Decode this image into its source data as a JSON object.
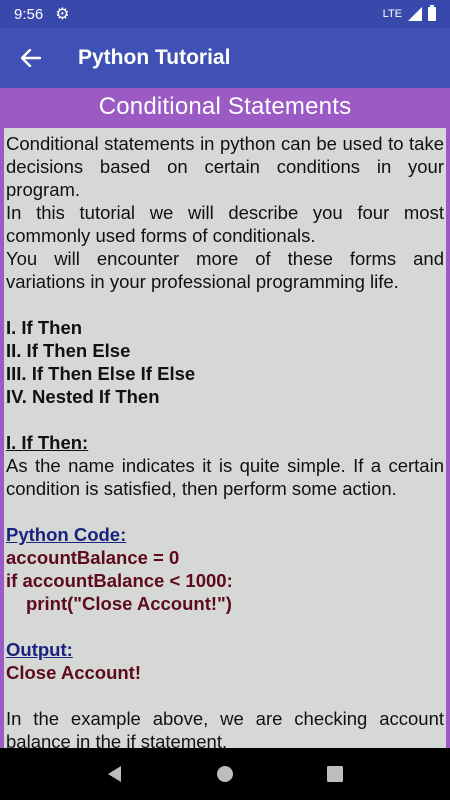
{
  "status": {
    "time": "9:56",
    "network": "LTE"
  },
  "app": {
    "title": "Python Tutorial"
  },
  "section": {
    "title": "Conditional Statements"
  },
  "body": {
    "intro1": "Conditional statements in python can be used to take decisions based on certain conditions in your program.",
    "intro2": "In this tutorial we will describe you four most commonly used forms of conditionals.",
    "intro3": "You will encounter more of these forms and variations in your professional programming life.",
    "list": [
      "I. If Then",
      "II. If Then Else",
      "III. If Then Else If Else",
      "IV. Nested If Then"
    ],
    "sub_heading": "I. If Then:",
    "sub_desc": "As the name indicates it is quite simple. If a certain condition is satisfied, then perform some action.",
    "code_heading": "Python Code:",
    "code_lines": [
      "accountBalance = 0",
      "if accountBalance < 1000:",
      "print(\"Close Account!\")"
    ],
    "output_heading": "Output:",
    "output_text": "Close Account!",
    "outro": "In the example above, we are checking account balance in the if statement."
  },
  "colors": {
    "status_bar": "#3949ab",
    "app_bar": "#3f51b5",
    "section_bg": "#9c5bc4",
    "panel_bg": "#d6d8d6",
    "code_heading": "#1a237e",
    "code_text": "#5d0a20"
  }
}
